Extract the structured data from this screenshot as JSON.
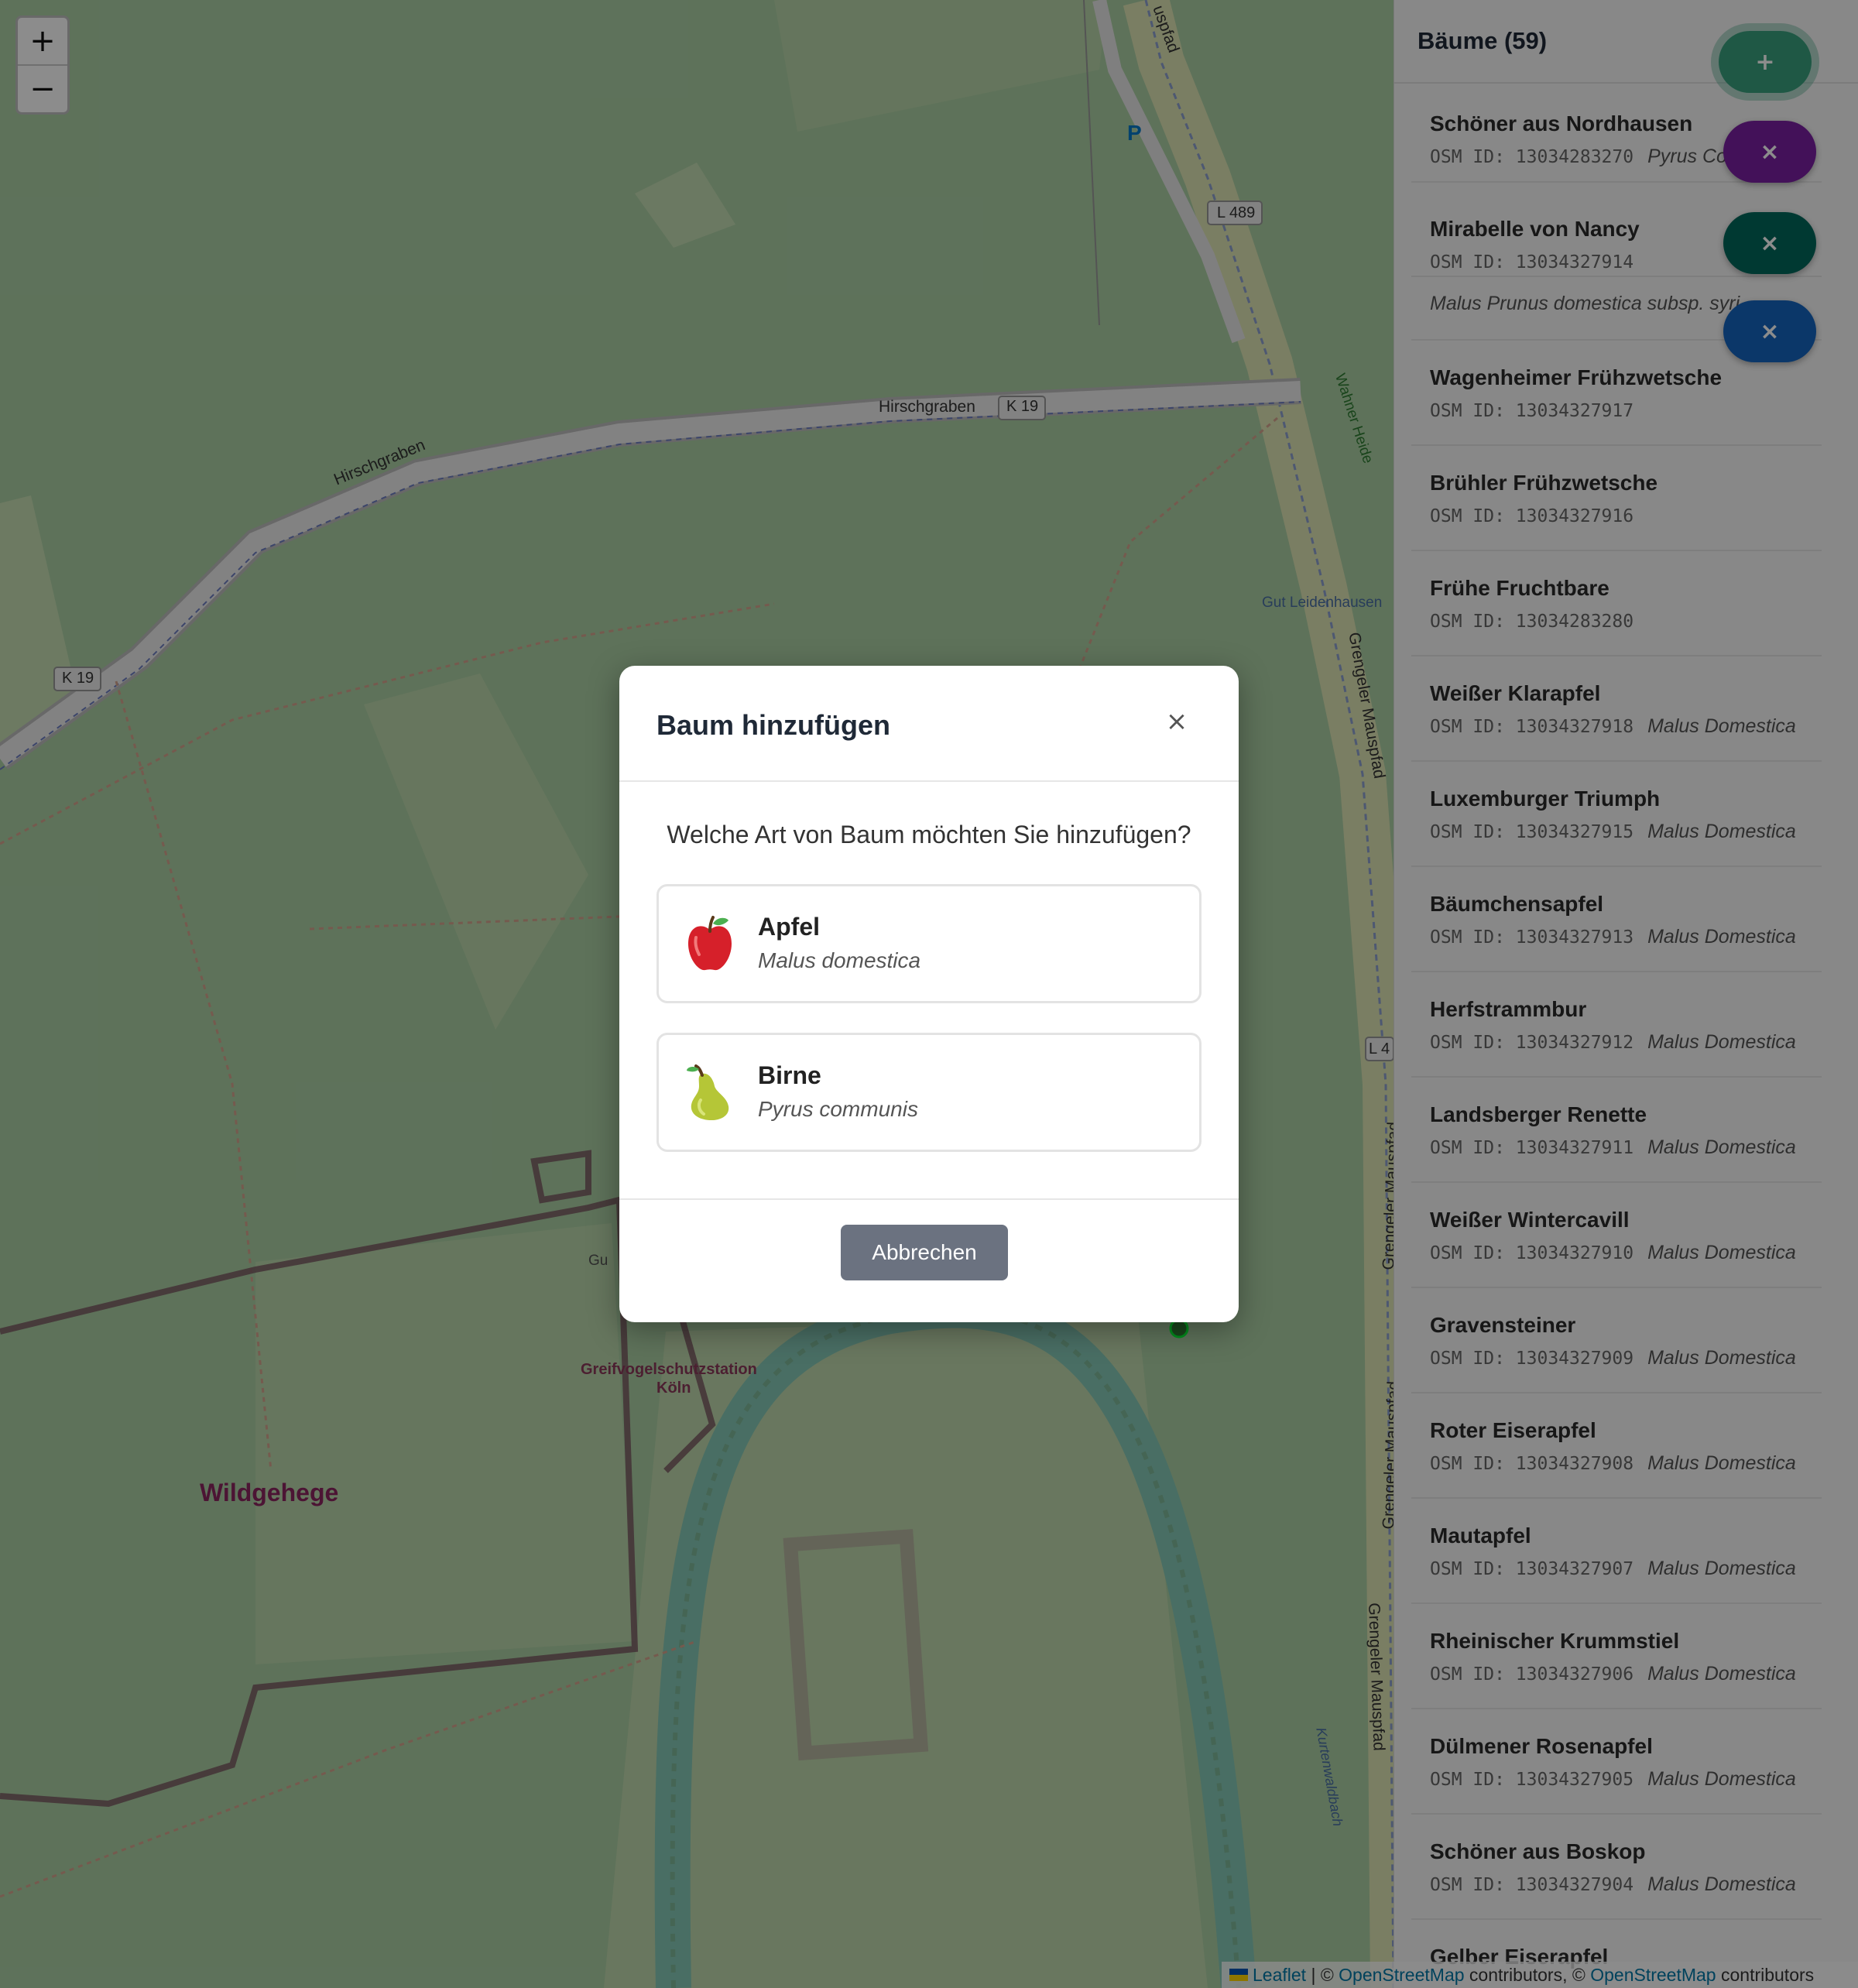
{
  "map": {
    "zoom_in": "+",
    "zoom_out": "−",
    "labels": {
      "hirschgraben_1": "Hirschgraben",
      "hirschgraben_2": "Hirschgraben",
      "k19_1": "K 19",
      "k19_2": "K 19",
      "l489": "L 489",
      "l4": "L 4",
      "parking": "P",
      "uspfad": "uspfad",
      "wahner_heide": "Wahner Heide",
      "gut_leidenhausen": "Gut Leidenhausen",
      "grengeler_1": "Grengeler Mauspfad",
      "grengeler_2": "Grengeler Mauspfad",
      "grengeler_3": "Grengeler Mauspfad",
      "grengeler_4": "Grengeler Mauspfad",
      "station_line1": "Greifvogelschutzstation",
      "station_line2": "Köln",
      "wildgehege": "Wildgehege",
      "kurtenwaldbach": "Kurtenwaldbach",
      "gut": "Gu"
    }
  },
  "sidebar": {
    "title": "Bäume (59)",
    "items": [
      {
        "name": "Schöner aus Nordhausen",
        "osm": "OSM ID: 13034283270",
        "sci": "Pyrus Com"
      },
      {
        "name": "Mirabelle von Nancy",
        "osm": "OSM ID: 13034327914",
        "sci": ""
      },
      {
        "name": "",
        "osm": "",
        "sci": "Malus Prunus domestica subsp. syri"
      },
      {
        "name": "Wagenheimer Frühzwetsche",
        "osm": "OSM ID: 13034327917",
        "sci": ""
      },
      {
        "name": "Brühler Frühzwetsche",
        "osm": "OSM ID: 13034327916",
        "sci": ""
      },
      {
        "name": "Frühe Fruchtbare",
        "osm": "OSM ID: 13034283280",
        "sci": ""
      },
      {
        "name": "Weißer Klarapfel",
        "osm": "OSM ID: 13034327918",
        "sci": "Malus Domestica"
      },
      {
        "name": "Luxemburger Triumph",
        "osm": "OSM ID: 13034327915",
        "sci": "Malus Domestica"
      },
      {
        "name": "Bäumchensapfel",
        "osm": "OSM ID: 13034327913",
        "sci": "Malus Domestica"
      },
      {
        "name": "Herfstrammbur",
        "osm": "OSM ID: 13034327912",
        "sci": "Malus Domestica"
      },
      {
        "name": "Landsberger Renette",
        "osm": "OSM ID: 13034327911",
        "sci": "Malus Domestica"
      },
      {
        "name": "Weißer Wintercavill",
        "osm": "OSM ID: 13034327910",
        "sci": "Malus Domestica"
      },
      {
        "name": "Gravensteiner",
        "osm": "OSM ID: 13034327909",
        "sci": "Malus Domestica"
      },
      {
        "name": "Roter Eiserapfel",
        "osm": "OSM ID: 13034327908",
        "sci": "Malus Domestica"
      },
      {
        "name": "Mautapfel",
        "osm": "OSM ID: 13034327907",
        "sci": "Malus Domestica"
      },
      {
        "name": "Rheinischer Krummstiel",
        "osm": "OSM ID: 13034327906",
        "sci": "Malus Domestica"
      },
      {
        "name": "Dülmener Rosenapfel",
        "osm": "OSM ID: 13034327905",
        "sci": "Malus Domestica"
      },
      {
        "name": "Schöner aus Boskop",
        "osm": "OSM ID: 13034327904",
        "sci": "Malus Domestica"
      },
      {
        "name": "Gelber Eiserapfel",
        "osm": "",
        "sci": ""
      }
    ],
    "fab_add": "+",
    "fab_close": "×",
    "fab_colors": {
      "add": "#3aa17e",
      "purple": "#7b1fa2",
      "teal": "#00695c",
      "blue": "#1565c0"
    }
  },
  "attribution": {
    "leaflet": "Leaflet",
    "sep": "| ©",
    "osm1": "OpenStreetMap",
    "mid": "contributors, ©",
    "osm2": "OpenStreetMap",
    "end": "contributors"
  },
  "modal": {
    "title": "Baum hinzufügen",
    "close": "×",
    "question": "Welche Art von Baum möchten Sie hinzufügen?",
    "options": [
      {
        "name": "Apfel",
        "sci": "Malus domestica",
        "icon": "apple-icon"
      },
      {
        "name": "Birne",
        "sci": "Pyrus communis",
        "icon": "pear-icon"
      }
    ],
    "cancel": "Abbrechen"
  }
}
